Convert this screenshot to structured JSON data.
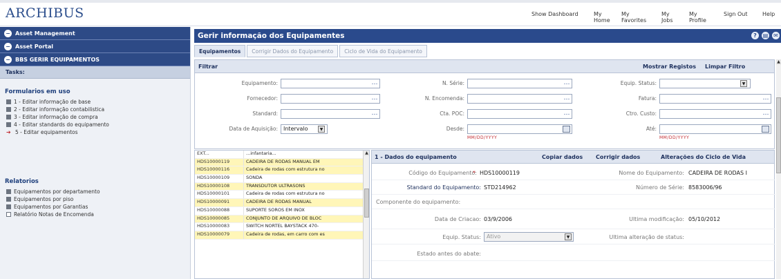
{
  "app": {
    "logo": "ARCHIBUS"
  },
  "topnav": [
    "Show Dashboard",
    "My Home",
    "My Favorites",
    "My Jobs",
    "My Profile",
    "Sign Out",
    "Help"
  ],
  "leftnav": {
    "modules": [
      "Asset Management",
      "Asset Portal",
      "BBS GERIR EQUIPAMENTOS"
    ],
    "tasks_label": "Tasks:",
    "forms_title": "Formularios em uso",
    "forms": [
      "1 - Editar informação de base",
      "2 - Editar informação contabilistica",
      "3 - Editar informação de compra",
      "4 - Editar standards do equipamento",
      "5 - Editar equipamentos"
    ],
    "reports_title": "Relatorios",
    "reports": [
      "Equipamentos por departamento",
      "Equipamentos por piso",
      "Equipamentos por Garantias",
      "Relatório Notas de Encomenda"
    ]
  },
  "main": {
    "title": "Gerir informação dos Equipamentes",
    "tabs": [
      "Equipamentos",
      "Corrigir Dados do Equipamento",
      "Ciclo de Vida do Equipamento"
    ],
    "filter": {
      "label": "Filtrar",
      "show_records": "Mostrar Registos",
      "clear_filter": "Limpar Filtro",
      "fields": {
        "equipamento": "Equipamento:",
        "n_serie": "N. Série:",
        "equip_status": "Equip. Status:",
        "fornecedor": "Fornecedor:",
        "n_encomenda": "N. Encomenda:",
        "fatura": "Fatura:",
        "standard": "Standard:",
        "cta_poc": "Cta. POC:",
        "ctro_custo": "Ctro. Custo:",
        "data_aquisicao": "Data de Aquisição:",
        "data_aquisicao_value": "Intervalo",
        "desde": "Desde:",
        "ate": "Até:",
        "date_format_hint": "MM/DD/YYYY"
      }
    },
    "list": {
      "rows": [
        {
          "code": "EXT...",
          "desc": "...infantaria..."
        },
        {
          "code": "HDS10000119",
          "desc": "CADEIRA DE RODAS MANUAL EM"
        },
        {
          "code": "HDS10000116",
          "desc": "Cadeira de rodas com estrutura no"
        },
        {
          "code": "HDS10000109",
          "desc": "SONDA"
        },
        {
          "code": "HDS10000108",
          "desc": "TRANSDUTOR ULTRASONS"
        },
        {
          "code": "HDS10000101",
          "desc": "Cadeira de rodas com estrutura no"
        },
        {
          "code": "HDS10000091",
          "desc": "CADEIRA DE RODAS MANUAL"
        },
        {
          "code": "HDS10000088",
          "desc": "SUPORTE SOROS EM INOX"
        },
        {
          "code": "HDS10000085",
          "desc": "CONJUNTO DE ARQUIVO DE BLOC"
        },
        {
          "code": "HDS10000083",
          "desc": "SWITCH NORTEL BAYSTACK 470-"
        },
        {
          "code": "HDS10000079",
          "desc": "Cadeira de rodas, em carro com es"
        }
      ]
    },
    "detail": {
      "header": "1 - Dados do equipamento",
      "copy": "Copiar dados",
      "correct": "Corrigir dados",
      "lifecycle": "Alterações do Ciclo de Vida",
      "fields": {
        "codigo_label": "Código do Equipamento:",
        "codigo_required": "*",
        "codigo_value": "HDS10000119",
        "nome_label": "Nome do Equipamento:",
        "nome_value": "CADEIRA DE RODAS I",
        "standard_label": "Standard do Equipamento:",
        "standard_value": "STD214962",
        "serie_label": "Número de Série:",
        "serie_value": "8583006/96",
        "componente_label": "Componente do equipamento:",
        "criacao_label": "Data de Criacao:",
        "criacao_value": "03/9/2006",
        "modificacao_label": "Ultima modificação:",
        "modificacao_value": "05/10/2012",
        "status_label": "Equip. Status:",
        "status_value": "Ativo",
        "ultima_status_label": "Ultima alteração de status:",
        "estado_label": "Estado antes do abate:"
      }
    }
  },
  "colors": {
    "brand": "#2a4a8c",
    "selected_row": "#fff6b8",
    "required": "#c0252b"
  }
}
